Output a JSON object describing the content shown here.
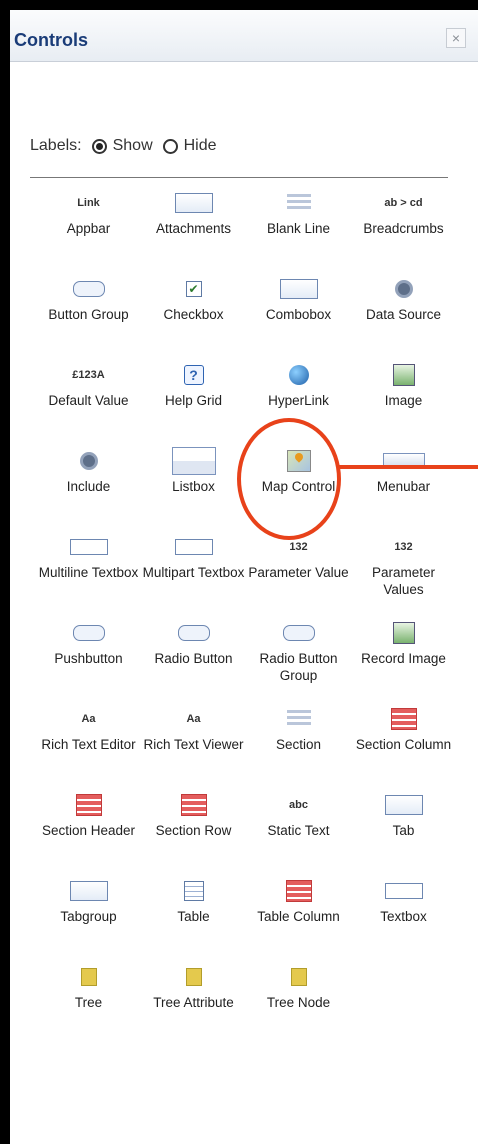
{
  "panel": {
    "title": "Controls",
    "close_symbol": "×"
  },
  "labels_option": {
    "label": "Labels:",
    "show": "Show",
    "hide": "Hide",
    "selected": "Show"
  },
  "controls": [
    {
      "label": "Appbar",
      "icon": "link-icon",
      "icon_text": "Link"
    },
    {
      "label": "Attachments",
      "icon": "attachment-icon",
      "icon_text": ""
    },
    {
      "label": "Blank Line",
      "icon": "blank-line-icon",
      "icon_text": ""
    },
    {
      "label": "Breadcrumbs",
      "icon": "breadcrumbs-icon",
      "icon_text": "ab > cd"
    },
    {
      "label": "Button Group",
      "icon": "button-group-icon",
      "icon_text": ""
    },
    {
      "label": "Checkbox",
      "icon": "checkbox-icon",
      "icon_text": "✔"
    },
    {
      "label": "Combobox",
      "icon": "combobox-icon",
      "icon_text": ""
    },
    {
      "label": "Data Source",
      "icon": "data-source-icon",
      "icon_text": ""
    },
    {
      "label": "Default Value",
      "icon": "default-value-icon",
      "icon_text": "£123A"
    },
    {
      "label": "Help Grid",
      "icon": "help-grid-icon",
      "icon_text": "?"
    },
    {
      "label": "HyperLink",
      "icon": "hyperlink-icon",
      "icon_text": ""
    },
    {
      "label": "Image",
      "icon": "image-icon",
      "icon_text": ""
    },
    {
      "label": "Include",
      "icon": "include-icon",
      "icon_text": ""
    },
    {
      "label": "Listbox",
      "icon": "listbox-icon",
      "icon_text": ""
    },
    {
      "label": "Map Control",
      "icon": "map-icon",
      "icon_text": ""
    },
    {
      "label": "Menubar",
      "icon": "menubar-icon",
      "icon_text": ""
    },
    {
      "label": "Multiline Textbox",
      "icon": "multiline-textbox-icon",
      "icon_text": ""
    },
    {
      "label": "Multipart Textbox",
      "icon": "multipart-textbox-icon",
      "icon_text": ""
    },
    {
      "label": "Parameter Value",
      "icon": "parameter-value-icon",
      "icon_text": "132"
    },
    {
      "label": "Parameter Values",
      "icon": "parameter-values-icon",
      "icon_text": "132"
    },
    {
      "label": "Pushbutton",
      "icon": "pushbutton-icon",
      "icon_text": ""
    },
    {
      "label": "Radio Button",
      "icon": "radio-button-icon",
      "icon_text": ""
    },
    {
      "label": "Radio Button Group",
      "icon": "radio-button-group-icon",
      "icon_text": ""
    },
    {
      "label": "Record Image",
      "icon": "record-image-icon",
      "icon_text": ""
    },
    {
      "label": "Rich Text Editor",
      "icon": "rich-text-editor-icon",
      "icon_text": "Aa"
    },
    {
      "label": "Rich Text Viewer",
      "icon": "rich-text-viewer-icon",
      "icon_text": "Aa"
    },
    {
      "label": "Section",
      "icon": "section-icon",
      "icon_text": ""
    },
    {
      "label": "Section Column",
      "icon": "section-column-icon",
      "icon_text": ""
    },
    {
      "label": "Section Header",
      "icon": "section-header-icon",
      "icon_text": ""
    },
    {
      "label": "Section Row",
      "icon": "section-row-icon",
      "icon_text": ""
    },
    {
      "label": "Static Text",
      "icon": "static-text-icon",
      "icon_text": "abc"
    },
    {
      "label": "Tab",
      "icon": "tab-icon",
      "icon_text": ""
    },
    {
      "label": "Tabgroup",
      "icon": "tabgroup-icon",
      "icon_text": ""
    },
    {
      "label": "Table",
      "icon": "table-icon",
      "icon_text": ""
    },
    {
      "label": "Table Column",
      "icon": "table-column-icon",
      "icon_text": ""
    },
    {
      "label": "Textbox",
      "icon": "textbox-icon",
      "icon_text": ""
    },
    {
      "label": "Tree",
      "icon": "tree-icon",
      "icon_text": ""
    },
    {
      "label": "Tree Attribute",
      "icon": "tree-attribute-icon",
      "icon_text": ""
    },
    {
      "label": "Tree Node",
      "icon": "tree-node-icon",
      "icon_text": ""
    }
  ],
  "highlight": {
    "target": "Map Control",
    "color": "#e8421a"
  }
}
